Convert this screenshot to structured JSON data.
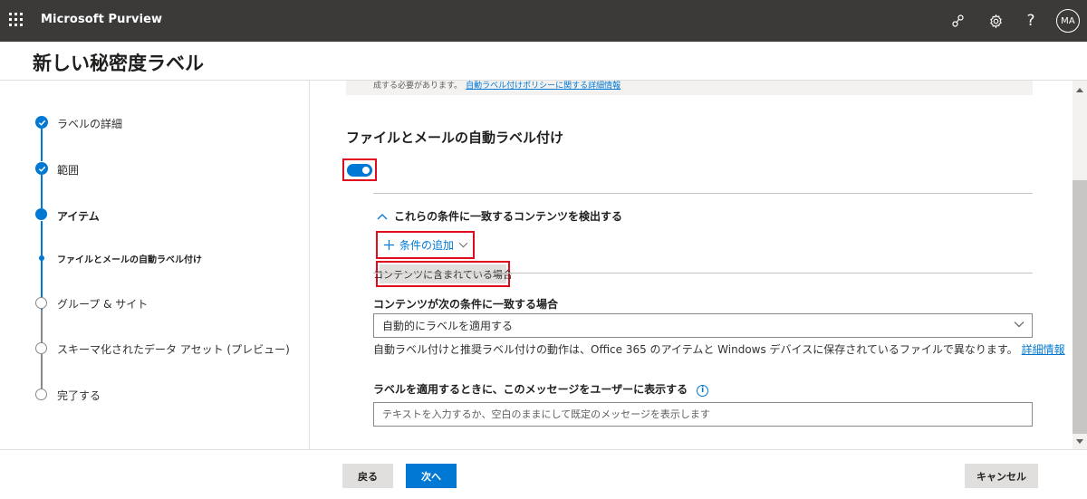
{
  "app": {
    "name": "Microsoft Purview",
    "user_initials": "MA"
  },
  "page": {
    "title": "新しい秘密度ラベル"
  },
  "steps": [
    {
      "label": "ラベルの詳細",
      "state": "completed"
    },
    {
      "label": "範囲",
      "state": "completed"
    },
    {
      "label": "アイテム",
      "state": "current"
    },
    {
      "label": "ファイルとメールの自動ラベル付け",
      "state": "current-substep"
    },
    {
      "label": "グループ & サイト",
      "state": "not-started"
    },
    {
      "label": "スキーマ化されたデータ アセット (プレビュー)",
      "state": "not-started"
    },
    {
      "label": "完了する",
      "state": "not-started"
    }
  ],
  "banner": {
    "text": "成する必要があります。",
    "link": "自動ラベル付けポリシーに関する詳細情報"
  },
  "section": {
    "title": "ファイルとメールの自動ラベル付け",
    "toggle_on": true,
    "conditions_header": "これらの条件に一致するコンテンツを検出する",
    "add_condition": "条件の追加",
    "condition_chip": "コンテンツに含まれている場合"
  },
  "match": {
    "label": "コンテンツが次の条件に一致する場合",
    "selected": "自動的にラベルを適用する",
    "help": "自動ラベル付けと推奨ラベル付けの動作は、Office 365 のアイテムと Windows デバイスに保存されているファイルで異なります。",
    "help_link": "詳細情報"
  },
  "message": {
    "label": "ラベルを適用するときに、このメッセージをユーザーに表示する",
    "placeholder": "テキストを入力するか、空白のままにして既定のメッセージを表示します"
  },
  "footer": {
    "back": "戻る",
    "next": "次へ",
    "cancel": "キャンセル"
  },
  "colors": {
    "accent": "#0078d4",
    "topbar": "#3b3a39",
    "highlight": "#e00b1c"
  }
}
